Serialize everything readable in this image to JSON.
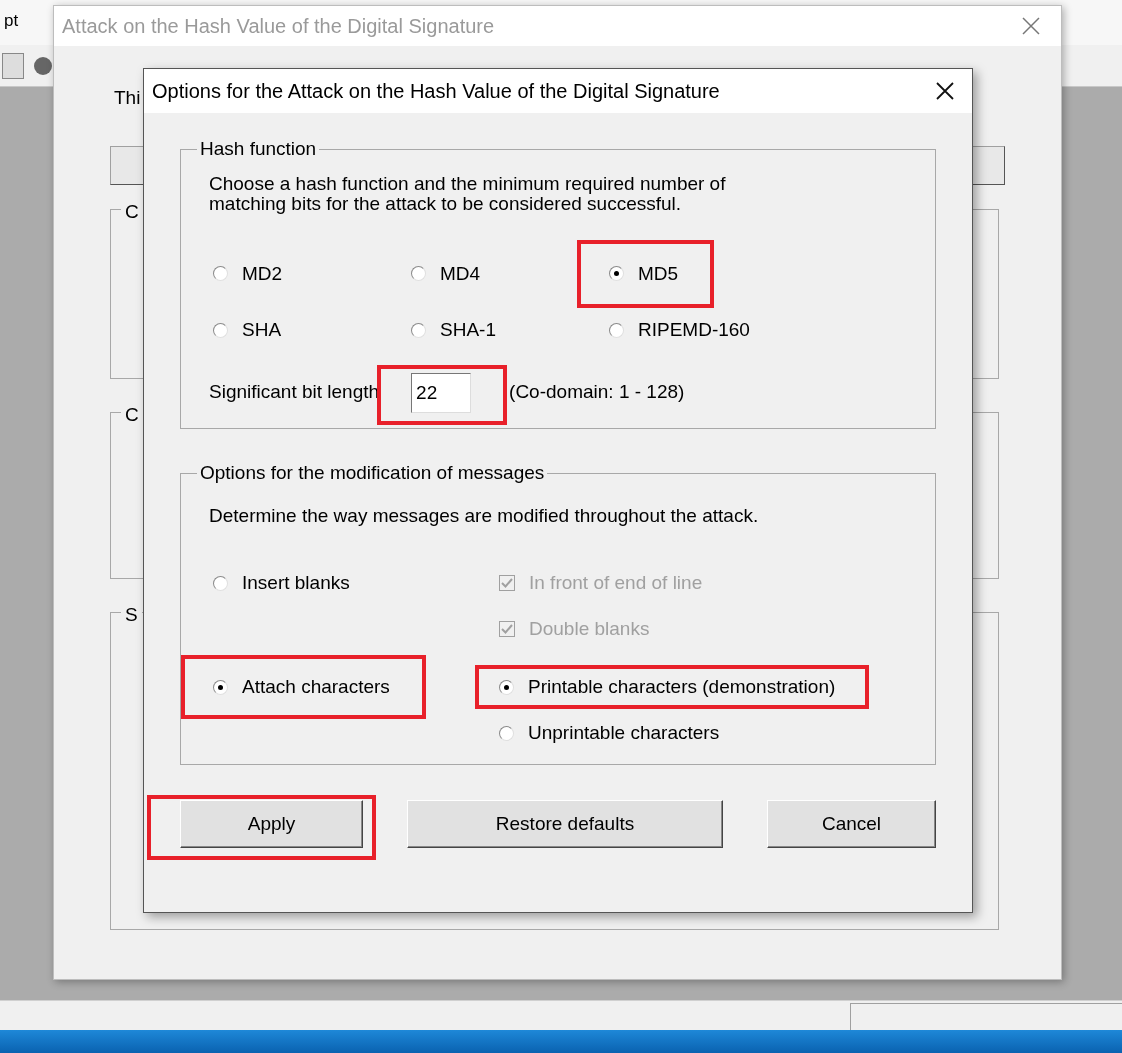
{
  "app": {
    "menu_fragment": "pt"
  },
  "back_window": {
    "title": "Attack on the Hash Value of the Digital Signature",
    "intro_fragment": "Thi",
    "group_fragments": [
      "C",
      "C",
      "S"
    ]
  },
  "dialog": {
    "title": "Options for the Attack on the Hash Value of the Digital Signature",
    "hash_group": {
      "legend": "Hash function",
      "description": "Choose a hash function and the minimum required number of\nmatching bits for the attack to be considered successful.",
      "options": [
        {
          "label": "MD2",
          "selected": false,
          "highlighted": false
        },
        {
          "label": "MD4",
          "selected": false,
          "highlighted": false
        },
        {
          "label": "MD5",
          "selected": true,
          "highlighted": true
        },
        {
          "label": "SHA",
          "selected": false,
          "highlighted": false
        },
        {
          "label": "SHA-1",
          "selected": false,
          "highlighted": false
        },
        {
          "label": "RIPEMD-160",
          "selected": false,
          "highlighted": false
        }
      ],
      "bit_length": {
        "label": "Significant bit length",
        "value": "22",
        "range": "(Co-domain: 1 - 128)",
        "highlighted": true
      }
    },
    "modification_group": {
      "legend": "Options for the modification of messages",
      "description": "Determine the way messages are modified throughout the attack.",
      "modes": [
        {
          "label": "Insert blanks",
          "selected": false,
          "highlighted": false,
          "suboptions": [
            {
              "kind": "checkbox",
              "label": "In front of end of line",
              "checked": true,
              "disabled": true
            },
            {
              "kind": "checkbox",
              "label": "Double blanks",
              "checked": true,
              "disabled": true
            }
          ]
        },
        {
          "label": "Attach characters",
          "selected": true,
          "highlighted": true,
          "suboptions": [
            {
              "kind": "radio",
              "label": "Printable characters (demonstration)",
              "selected": true,
              "highlighted": true
            },
            {
              "kind": "radio",
              "label": "Unprintable characters",
              "selected": false,
              "highlighted": false
            }
          ]
        }
      ]
    },
    "buttons": [
      {
        "label": "Apply",
        "highlighted": true
      },
      {
        "label": "Restore defaults",
        "highlighted": false
      },
      {
        "label": "Cancel",
        "highlighted": false
      }
    ]
  }
}
